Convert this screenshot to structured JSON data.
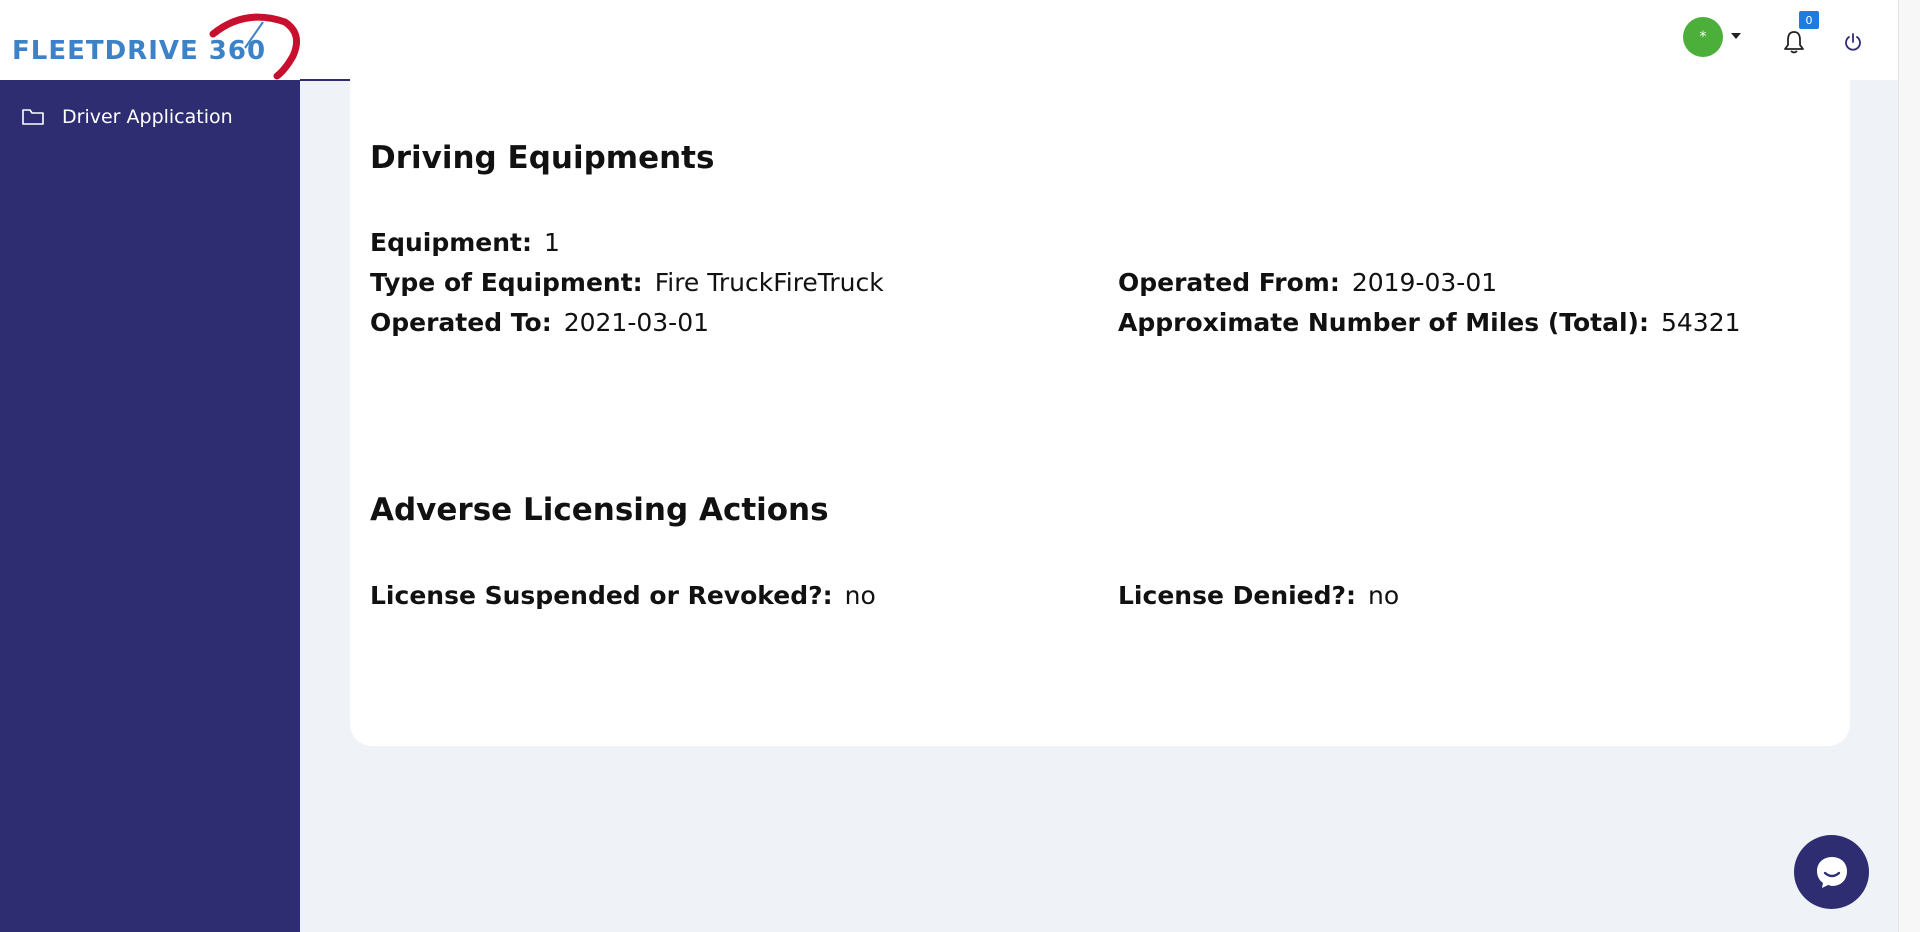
{
  "header": {
    "logo_text": "FLEETDRIVE 360",
    "avatar_initial": "*",
    "notification_count": "0"
  },
  "sidebar": {
    "items": [
      {
        "label": "Driver Application",
        "icon": "folder-icon"
      }
    ]
  },
  "driving_equipments": {
    "title": "Driving Equipments",
    "equipment_label": "Equipment:",
    "equipment_value": "1",
    "type_label": "Type of Equipment:",
    "type_value": "Fire TruckFireTruck",
    "from_label": "Operated From:",
    "from_value": "2019-03-01",
    "to_label": "Operated To:",
    "to_value": "2021-03-01",
    "miles_label": "Approximate Number of Miles (Total):",
    "miles_value": "54321"
  },
  "adverse_licensing": {
    "title": "Adverse Licensing Actions",
    "suspended_label": "License Suspended or Revoked?:",
    "suspended_value": "no",
    "denied_label": "License Denied?:",
    "denied_value": "no"
  },
  "colors": {
    "sidebar": "#2f2d72",
    "background": "#eff2f6",
    "avatar": "#4caf3a",
    "badge": "#1e7be0",
    "logo_blue": "#3b82c8",
    "logo_red": "#c8102e"
  }
}
